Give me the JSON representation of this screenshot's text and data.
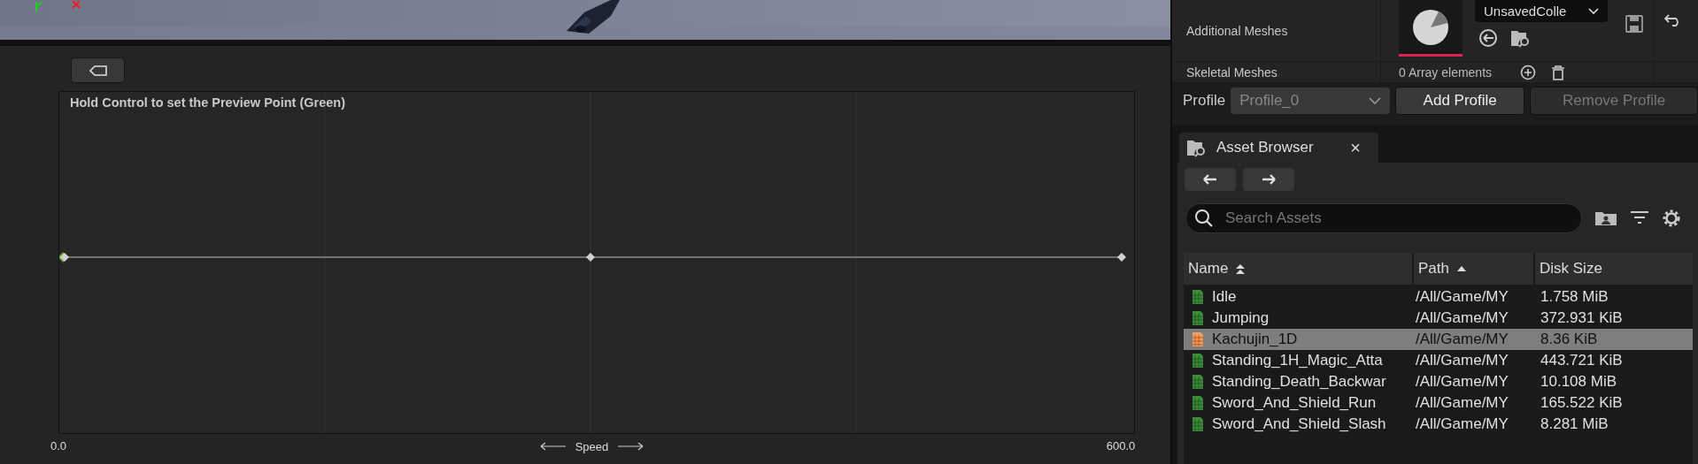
{
  "graph": {
    "hint": "Hold Control to set the Preview Point (Green)",
    "axis": {
      "min_label": "0.0",
      "title": "Speed",
      "max_label": "600.0"
    }
  },
  "details": {
    "rows": [
      {
        "label": "Additional Meshes",
        "kind": "asset",
        "asset": "UnsavedColle"
      },
      {
        "label": "Skeletal Meshes",
        "kind": "array",
        "value": "0 Array elements"
      }
    ]
  },
  "profile": {
    "label": "Profile",
    "value": "Profile_0",
    "buttons": [
      {
        "label": "Add Profile",
        "disabled": false
      },
      {
        "label": "Remove Profile",
        "disabled": true
      }
    ]
  },
  "asset_browser": {
    "tab": {
      "title": "Asset Browser",
      "close": "×"
    },
    "search": {
      "placeholder": "Search Assets"
    },
    "columns": [
      {
        "label": "Name",
        "kind": "secondary_sort"
      },
      {
        "label": "Path",
        "kind": "sorted"
      },
      {
        "label": "Disk Size",
        "kind": "plain"
      }
    ],
    "rows": [
      {
        "name": "Idle",
        "path": "/All/Game/MY",
        "size": "1.758 MiB",
        "kind": "animation",
        "selected": false
      },
      {
        "name": "Jumping",
        "path": "/All/Game/MY",
        "size": "372.931 KiB",
        "kind": "animation",
        "selected": false
      },
      {
        "name": "Kachujin_1D",
        "path": "/All/Game/MY",
        "size": "8.36 KiB",
        "kind": "blendspace",
        "selected": true
      },
      {
        "name": "Standing_1H_Magic_Atta",
        "path": "/All/Game/MY",
        "size": "443.721 KiB",
        "kind": "animation",
        "selected": false
      },
      {
        "name": "Standing_Death_Backwar",
        "path": "/All/Game/MY",
        "size": "10.108 MiB",
        "kind": "animation",
        "selected": false
      },
      {
        "name": "Sword_And_Shield_Run",
        "path": "/All/Game/MY",
        "size": "165.522 KiB",
        "kind": "animation",
        "selected": false
      },
      {
        "name": "Sword_And_Shield_Slash",
        "path": "/All/Game/MY",
        "size": "8.281 MiB",
        "kind": "animation",
        "selected": false
      }
    ]
  }
}
